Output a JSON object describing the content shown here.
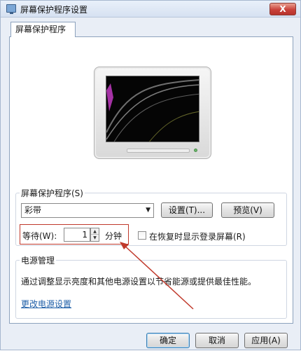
{
  "window": {
    "title": "屏幕保护程序设置",
    "close_label": "X"
  },
  "tab": {
    "label": "屏幕保护程序"
  },
  "screensaver": {
    "group_label": "屏幕保护程序(S)",
    "selected": "彩带",
    "settings_button": "设置(T)...",
    "preview_button": "预览(V)",
    "wait_label": "等待(W):",
    "wait_value": "1",
    "minutes_label": "分钟",
    "logon_checkbox_label": "在恢复时显示登录屏幕(R)",
    "logon_checked": false
  },
  "power": {
    "group_label": "电源管理",
    "description": "通过调整显示亮度和其他电源设置以节省能源或提供最佳性能。",
    "link": "更改电源设置"
  },
  "footer": {
    "ok": "确定",
    "cancel": "取消",
    "apply": "应用(A)"
  },
  "colors": {
    "highlight": "#c0392b",
    "link": "#1f5fa8"
  }
}
